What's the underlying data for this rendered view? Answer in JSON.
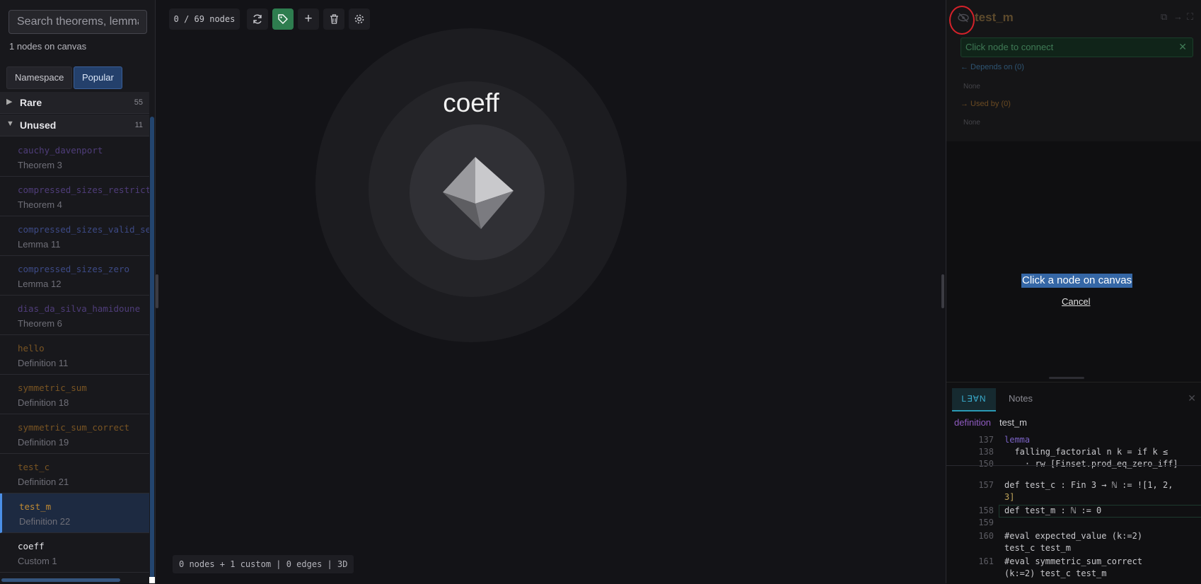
{
  "sidebar": {
    "search_placeholder": "Search theorems, lemmas...",
    "node_count": "1 nodes on canvas",
    "view_namespace": "Namespace",
    "view_popular": "Popular",
    "sections": [
      {
        "name": "Rare",
        "count": "55",
        "expanded": false
      },
      {
        "name": "Unused",
        "count": "11",
        "expanded": true
      }
    ],
    "items": [
      {
        "name": "cauchy_davenport",
        "sub": "Theorem 3",
        "color": "#4f3d7a"
      },
      {
        "name": "compressed_sizes_restrict",
        "sub": "Theorem 4",
        "color": "#4f3d7a"
      },
      {
        "name": "compressed_sizes_valid_se",
        "sub": "Lemma 11",
        "color": "#3d4a86"
      },
      {
        "name": "compressed_sizes_zero",
        "sub": "Lemma 12",
        "color": "#3d4a86"
      },
      {
        "name": "dias_da_silva_hamidoune",
        "sub": "Theorem 6",
        "color": "#4f3d7a"
      },
      {
        "name": "hello",
        "sub": "Definition 11",
        "color": "#7a5523"
      },
      {
        "name": "symmetric_sum",
        "sub": "Definition 18",
        "color": "#7a5523"
      },
      {
        "name": "symmetric_sum_correct",
        "sub": "Definition 19",
        "color": "#7a5523"
      },
      {
        "name": "test_c",
        "sub": "Definition 21",
        "color": "#7a5523"
      },
      {
        "name": "test_m",
        "sub": "Definition 22",
        "color": "#c08a32",
        "selected": true
      },
      {
        "name": "coeff",
        "sub": "Custom 1",
        "color": "#e6e6ea"
      }
    ]
  },
  "canvas": {
    "node_counter": "0 / 69 nodes",
    "status": "0 nodes + 1 custom | 0 edges | 3D",
    "node_label": "coeff",
    "icons": [
      "refresh-icon",
      "tag-icon",
      "plus-icon",
      "trash-icon",
      "gear-icon"
    ]
  },
  "panel": {
    "title": "test_m",
    "connect_hint": "Click node to connect",
    "connect_close": "✕",
    "depends_label": "← Depends on (0)",
    "depends_none": "None",
    "used_label": "→ Used by (0)",
    "used_none": "None",
    "prompt": "Click a node on canvas",
    "cancel": "Cancel"
  },
  "editor": {
    "tab_lean": "L∃∀N",
    "tab_notes": "Notes",
    "close": "✕",
    "def_keyword": "definition",
    "def_name": "test_m",
    "lines": [
      {
        "n": "137",
        "text": "lemma"
      },
      {
        "n": "138",
        "text": "  falling_factorial n k = if k ≤"
      },
      {
        "n": "150",
        "text": "    · rw [Finset.prod_eq_zero_iff]"
      },
      {
        "n": "157",
        "text": "def test_c : Fin 3 → ℕ := ![1, 2,"
      },
      {
        "n": "",
        "text": "3]"
      },
      {
        "n": "158",
        "text": "def test_m : ℕ := 0"
      },
      {
        "n": "159",
        "text": ""
      },
      {
        "n": "160",
        "text": "#eval expected_value (k:=2)"
      },
      {
        "n": "",
        "text": "test_c test_m"
      },
      {
        "n": "161",
        "text": "#eval symmetric_sum_correct"
      },
      {
        "n": "",
        "text": "(k:=2) test_c test_m"
      }
    ]
  }
}
